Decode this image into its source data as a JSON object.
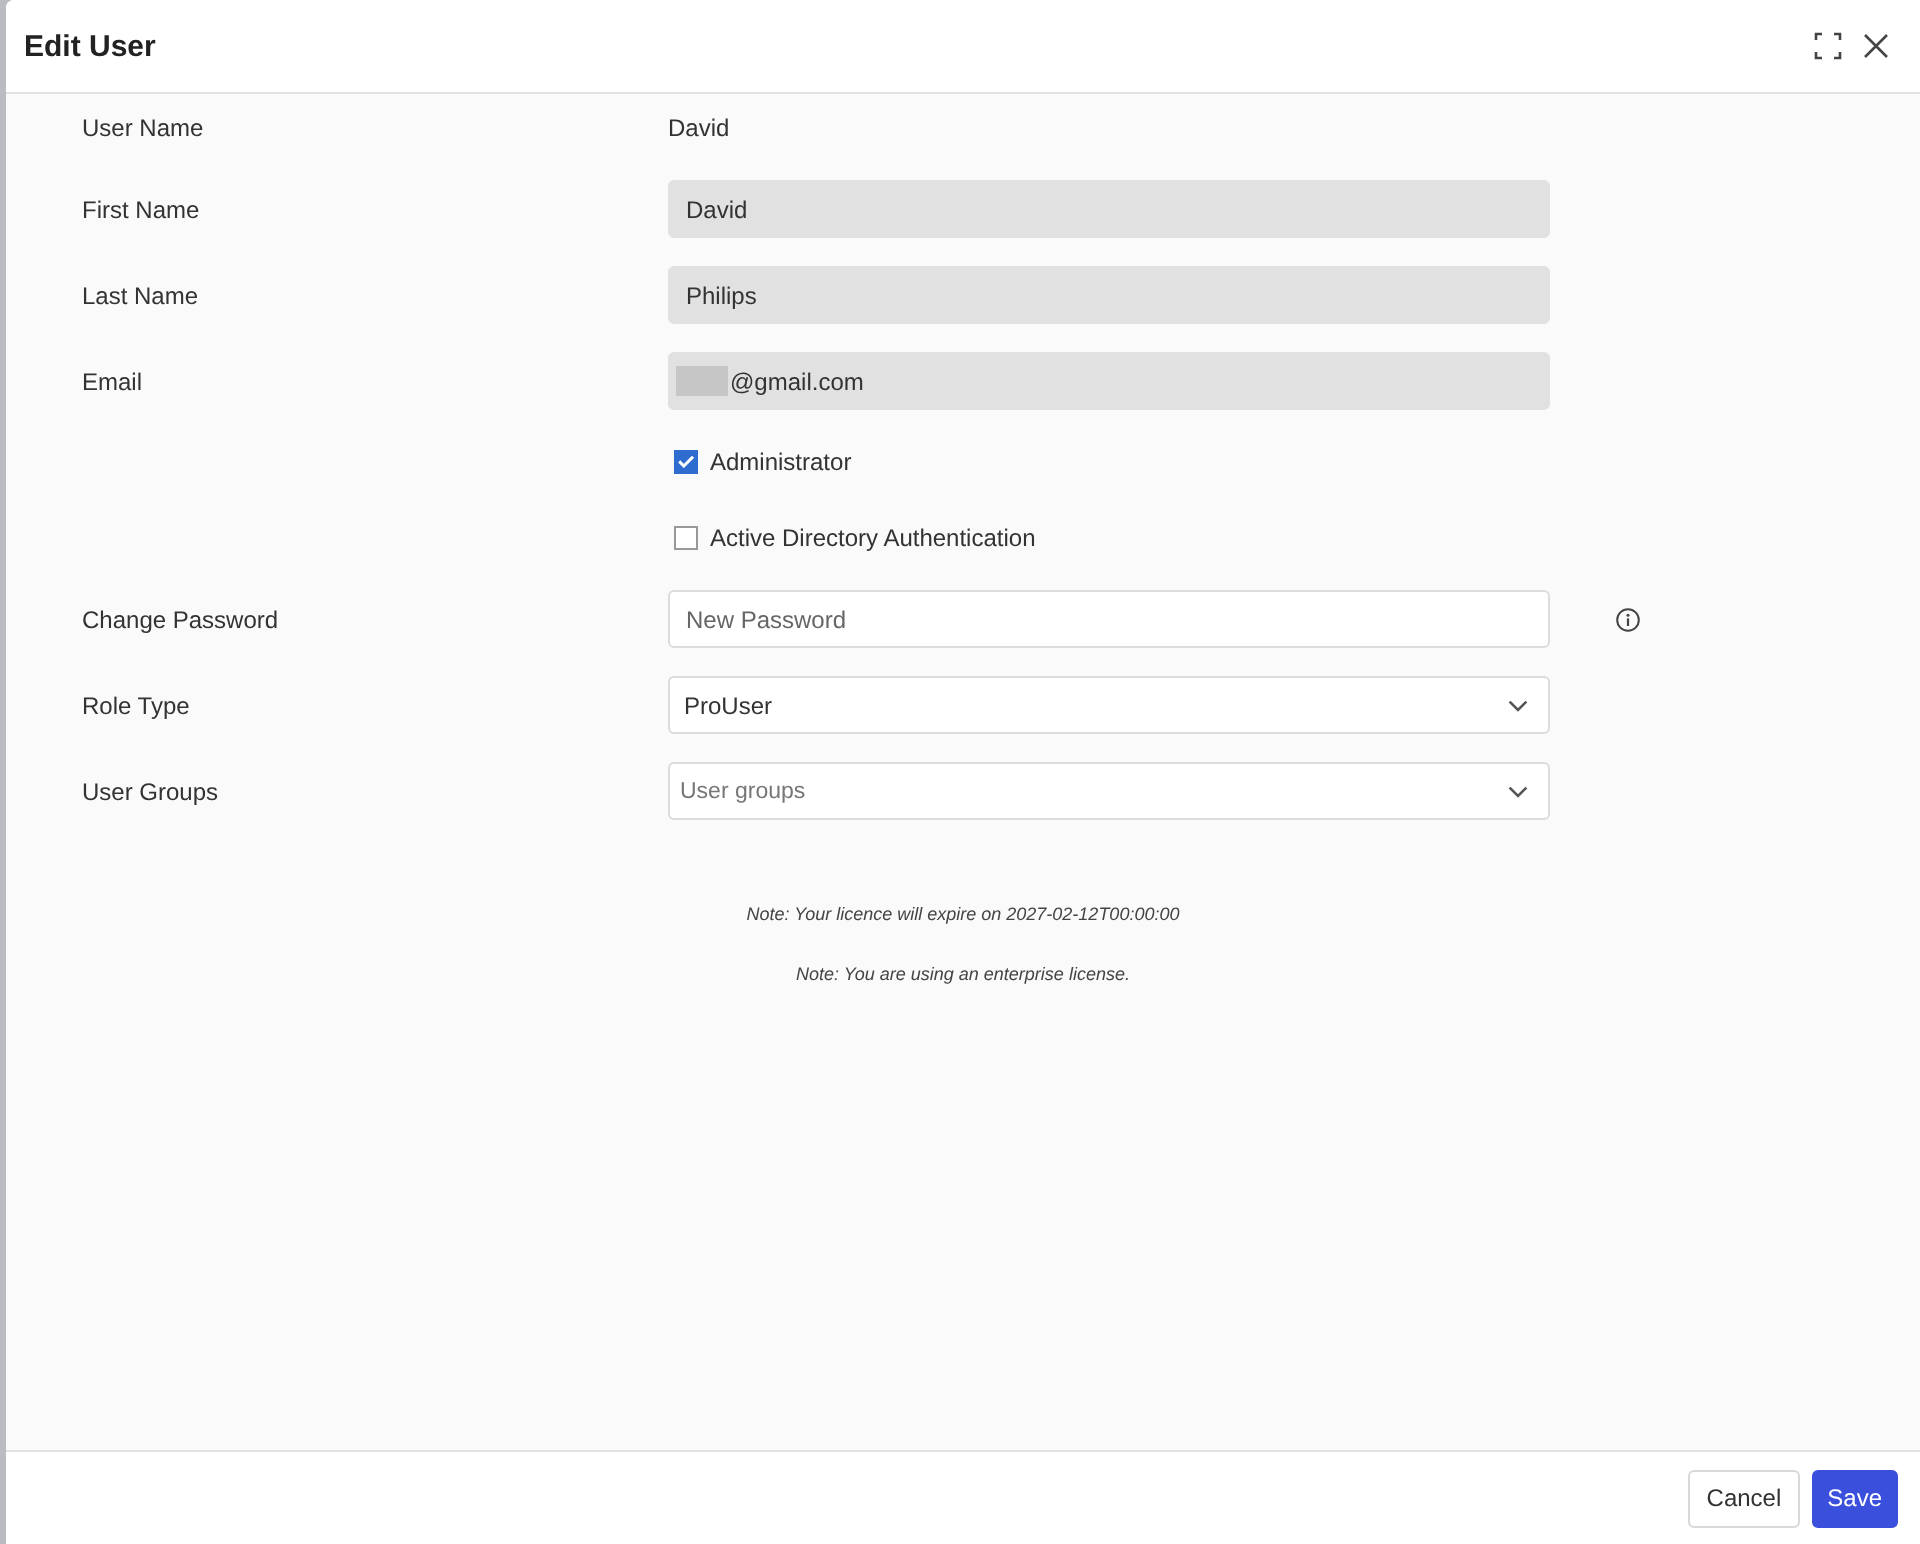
{
  "dialog": {
    "title": "Edit User"
  },
  "fields": [
    {
      "kind": "text",
      "label": "User Name",
      "value": "David"
    },
    {
      "kind": "input",
      "label": "First Name",
      "value": "David",
      "disabled": true
    },
    {
      "kind": "input",
      "label": "Last Name",
      "value": "Philips",
      "disabled": true
    },
    {
      "kind": "input",
      "label": "Email",
      "value": "@gmail.com",
      "disabled": true,
      "redacted_prefix": true
    },
    {
      "kind": "checkbox",
      "label": "Administrator",
      "checked": true
    },
    {
      "kind": "checkbox",
      "label": "Active Directory Authentication",
      "checked": false
    },
    {
      "kind": "input",
      "label": "Change Password",
      "placeholder": "New Password",
      "disabled": false,
      "info": true
    },
    {
      "kind": "select",
      "label": "Role Type",
      "value": "ProUser"
    },
    {
      "kind": "select",
      "label": "User Groups",
      "placeholder": "User groups"
    }
  ],
  "notes": [
    "Note: Your licence will expire on 2027-02-12T00:00:00",
    "Note: You are using an enterprise license."
  ],
  "buttons": [
    {
      "label": "Cancel",
      "kind": "secondary"
    },
    {
      "label": "Save",
      "kind": "primary"
    }
  ]
}
